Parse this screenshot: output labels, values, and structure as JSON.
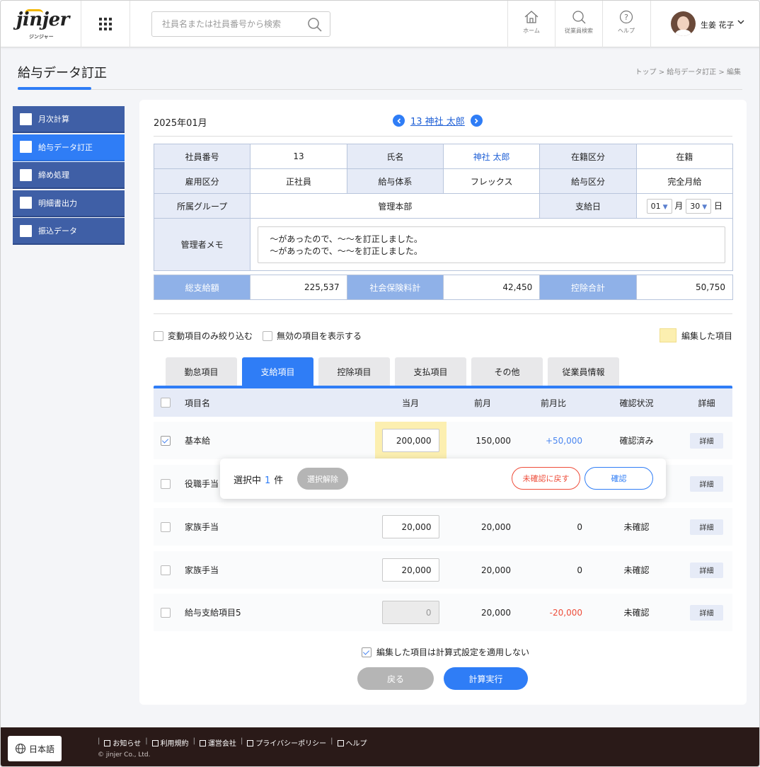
{
  "header": {
    "logo_text": "jinjer",
    "logo_sub": "ジンジャー",
    "search_placeholder": "社員名または社員番号から検索",
    "nav": [
      {
        "label": "ホーム",
        "icon": "home-icon"
      },
      {
        "label": "従業員検索",
        "icon": "search-icon"
      },
      {
        "label": "ヘルプ",
        "icon": "help-icon"
      }
    ],
    "user_name": "生姜 花子"
  },
  "page": {
    "title": "給与データ訂正",
    "breadcrumb": "トップ > 給与データ訂正 > 編集"
  },
  "sidebar": {
    "items": [
      {
        "label": "月次計算"
      },
      {
        "label": "給与データ訂正"
      },
      {
        "label": "締め処理"
      },
      {
        "label": "明細書出力"
      },
      {
        "label": "振込データ"
      }
    ]
  },
  "main": {
    "month": "2025年01月",
    "employee_link": "13 神社 太郎",
    "info": {
      "emp_no_label": "社員番号",
      "emp_no": "13",
      "name_label": "氏名",
      "name": "神社 太郎",
      "status_label": "在籍区分",
      "status": "在籍",
      "emp_type_label": "雇用区分",
      "emp_type": "正社員",
      "pay_system_label": "給与体系",
      "pay_system": "フレックス",
      "pay_type_label": "給与区分",
      "pay_type": "完全月給",
      "group_label": "所属グループ",
      "group": "管理本部",
      "payday_label": "支給日",
      "payday_month": "01",
      "month_unit": "月",
      "payday_day": "30",
      "day_unit": "日",
      "memo_label": "管理者メモ",
      "memo_line1": "〜があったので、〜〜を訂正しました。",
      "memo_line2": "〜があったので、〜〜を訂正しました。"
    },
    "totals": {
      "gross_label": "総支給額",
      "gross": "225,537",
      "insurance_label": "社会保険料計",
      "insurance": "42,450",
      "deduction_label": "控除合計",
      "deduction": "50,750"
    },
    "filters": {
      "changed_only": "変動項目のみ絞り込む",
      "show_invalid": "無効の項目を表示する",
      "edited_legend": "編集した項目"
    },
    "tabs": [
      "勤怠項目",
      "支給項目",
      "控除項目",
      "支払項目",
      "その他",
      "従業員情報"
    ],
    "columns": {
      "name": "項目名",
      "current": "当月",
      "previous": "前月",
      "diff": "前月比",
      "status": "確認状況",
      "detail": "詳細"
    },
    "rows": [
      {
        "name": "基本給",
        "current": "200,000",
        "previous": "150,000",
        "diff": "+50,000",
        "status": "確認済み",
        "detail": "詳細"
      },
      {
        "name": "役職手当",
        "detail": "詳細"
      },
      {
        "name": "家族手当",
        "current": "20,000",
        "previous": "20,000",
        "diff": "0",
        "status": "未確認",
        "detail": "詳細"
      },
      {
        "name": "家族手当",
        "current": "20,000",
        "previous": "20,000",
        "diff": "0",
        "status": "未確認",
        "detail": "詳細"
      },
      {
        "name": "給与支給項目5",
        "current": "0",
        "previous": "20,000",
        "diff": "-20,000",
        "status": "未確認",
        "detail": "詳細"
      }
    ],
    "selection": {
      "prefix": "選択中",
      "count": "1",
      "suffix": "件",
      "clear": "選択解除",
      "revert": "未確認に戻す",
      "confirm": "確認"
    },
    "no_formula": "編集した項目は計算式設定を適用しない",
    "back": "戻る",
    "run": "計算実行"
  },
  "footer": {
    "language": "日本語",
    "links": [
      "お知らせ",
      "利用規約",
      "運営会社",
      "プライバシーポリシー",
      "ヘルプ"
    ],
    "copyright": "© jinjer Co., Ltd."
  },
  "colors": {
    "accent": "#2f7df6",
    "sidebar": "#3f5fa6",
    "edited_highlight": "#fcefb0",
    "negative": "#ee4d3a",
    "footer": "#2a1a18"
  }
}
